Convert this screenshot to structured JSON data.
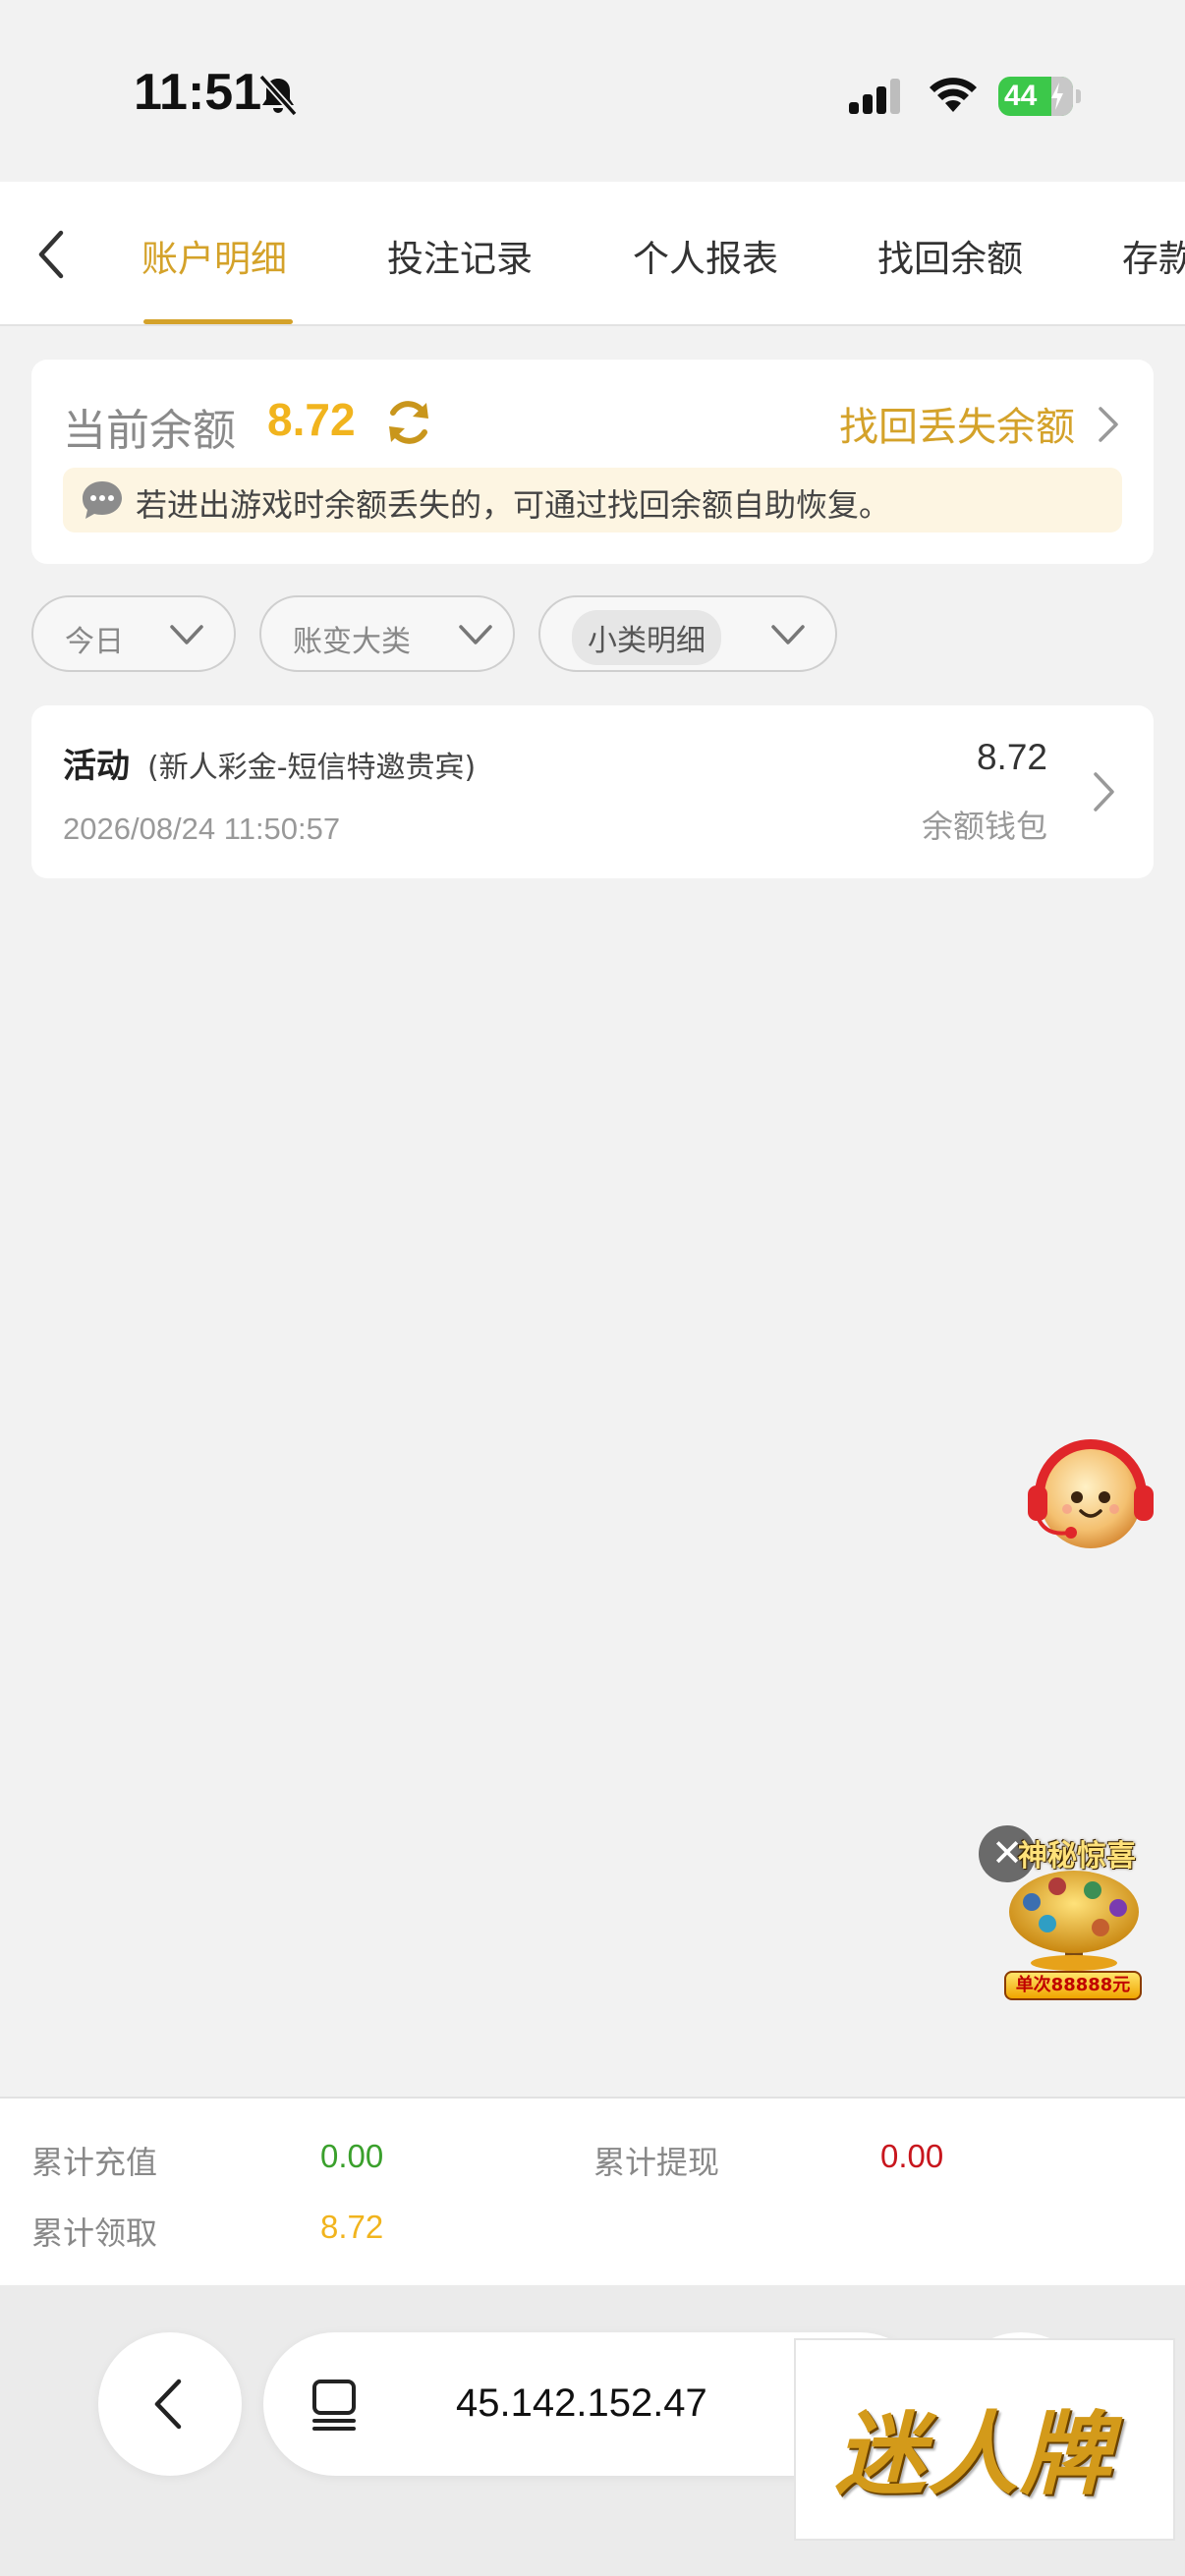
{
  "status_bar": {
    "time": "11:51",
    "battery": "44"
  },
  "tabs": [
    {
      "label": "账户明细",
      "active": true
    },
    {
      "label": "投注记录",
      "active": false
    },
    {
      "label": "个人报表",
      "active": false
    },
    {
      "label": "找回余额",
      "active": false
    },
    {
      "label": "存款",
      "active": false
    }
  ],
  "balance": {
    "label": "当前余额",
    "value": "8.72",
    "recover_link": "找回丢失余额",
    "tip": "若进出游戏时余额丢失的，可通过找回余额自助恢复。"
  },
  "filters": {
    "date": "今日",
    "category": "账变大类",
    "subcategory": "小类明细"
  },
  "records": [
    {
      "type": "活动",
      "detail": "(新人彩金-短信特邀贵宾)",
      "time": "2026/08/24 11:50:57",
      "amount": "8.72",
      "wallet": "余额钱包"
    }
  ],
  "promo": {
    "close": "✕",
    "title": "神秘惊喜",
    "badge": "单次88888元"
  },
  "summary": {
    "recharge_label": "累计充值",
    "recharge_value": "0.00",
    "withdraw_label": "累计提现",
    "withdraw_value": "0.00",
    "claimed_label": "累计领取",
    "claimed_value": "8.72"
  },
  "browser": {
    "url": "45.142.152.47"
  },
  "watermark": "迷人牌",
  "colors": {
    "accent": "#d4a22a",
    "balance": "#f1b41e",
    "recharge": "#3aa02c",
    "withdraw": "#c8161d",
    "claimed": "#f1b41e"
  }
}
